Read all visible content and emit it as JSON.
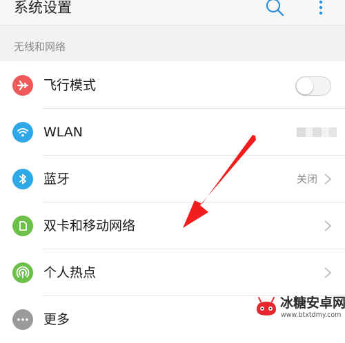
{
  "header": {
    "title": "系统设置",
    "search_icon": "search-icon",
    "more_icon": "more-vertical-icon"
  },
  "section": {
    "title": "无线和网络"
  },
  "items": [
    {
      "label": "飞行模式",
      "icon": "airplane-icon",
      "icon_color": "#ee5a5a",
      "control": "toggle",
      "toggle_on": false
    },
    {
      "label": "WLAN",
      "icon": "wifi-icon",
      "icon_color": "#2ea8e6",
      "control": "blurred-value"
    },
    {
      "label": "蓝牙",
      "icon": "bluetooth-icon",
      "icon_color": "#2ea8e6",
      "value": "关闭",
      "control": "chevron"
    },
    {
      "label": "双卡和移动网络",
      "icon": "sim-card-icon",
      "icon_color": "#6cc04a",
      "control": "chevron"
    },
    {
      "label": "个人热点",
      "icon": "hotspot-icon",
      "icon_color": "#6cc04a",
      "control": "chevron"
    },
    {
      "label": "更多",
      "icon": "more-dots-icon",
      "icon_color": "#9a9a9a",
      "control": "none"
    }
  ],
  "overlay": {
    "arrow_color": "#f21d1d"
  },
  "watermark": {
    "name": "冰糖安卓网",
    "url": "www.btxtdmy.com"
  }
}
